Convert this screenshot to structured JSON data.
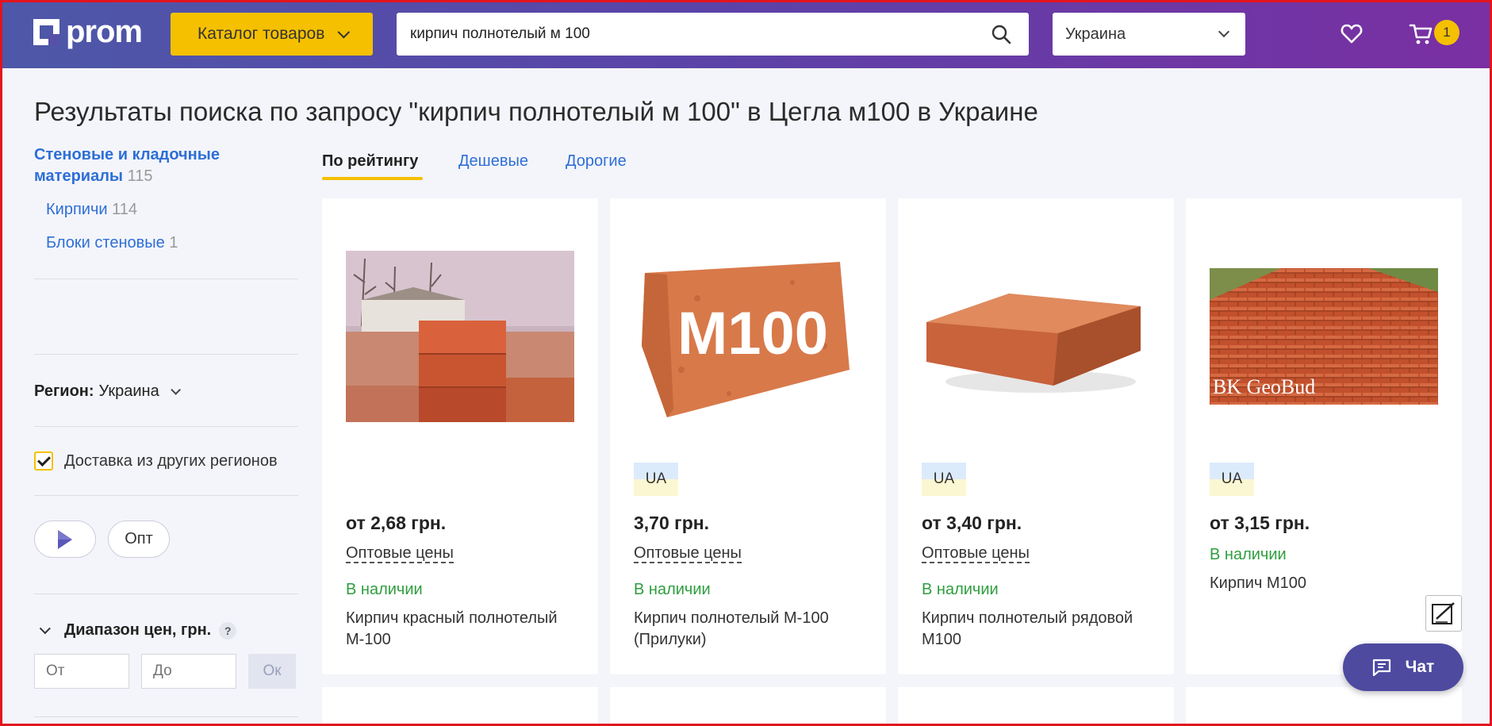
{
  "header": {
    "logo": "prom",
    "catalog_label": "Каталог товаров",
    "search_value": "кирпич полнотелый м 100",
    "region": "Украина",
    "cart_count": "1"
  },
  "page_title": "Результаты поиска по запросу \"кирпич полнотелый м 100\" в Цегла м100 в Украине",
  "sidebar": {
    "category_main_label": "Стеновые и кладочные материалы",
    "category_main_count": "115",
    "subcategories": [
      {
        "label": "Кирпичи",
        "count": "114"
      },
      {
        "label": "Блоки стеновые",
        "count": "1"
      }
    ],
    "region_label": "Регион:",
    "region_value": "Украина",
    "delivery_label": "Доставка из других регионов",
    "opt_label": "Опт",
    "price_range_label": "Диапазон цен, грн.",
    "help_glyph": "?",
    "price_from_placeholder": "От",
    "price_to_placeholder": "До",
    "ok_label": "Ок"
  },
  "sort_tabs": [
    {
      "label": "По рейтингу"
    },
    {
      "label": "Дешевые"
    },
    {
      "label": "Дорогие"
    }
  ],
  "products": [
    {
      "badge": "",
      "price": "от 2,68 грн.",
      "wholesale": "Оптовые цены",
      "stock": "В наличии",
      "name": "Кирпич красный полнотелый М-100",
      "image": "brick-stack-photo"
    },
    {
      "badge": "UA",
      "price": "3,70 грн.",
      "wholesale": "Оптовые цены",
      "stock": "В наличии",
      "name": "Кирпич полнотелый М-100 (Прилуки)",
      "image": "brick-m100-photo",
      "image_text": "M100"
    },
    {
      "badge": "UA",
      "price": "от 3,40 грн.",
      "wholesale": "Оптовые цены",
      "stock": "В наличии",
      "name": "Кирпич полнотелый рядовой М100",
      "image": "single-brick-photo"
    },
    {
      "badge": "UA",
      "price": "от 3,15 грн.",
      "wholesale": "",
      "stock": "В наличии",
      "name": "Кирпич М100",
      "image": "brick-pile-photo",
      "image_watermark": "BK GeoBud"
    }
  ],
  "chat_label": "Чат",
  "colors": {
    "accent_yellow": "#f5c000",
    "link_blue": "#2e6fd6",
    "stock_green": "#2e9e3e",
    "header_start": "#4d58a8",
    "header_end": "#7a2fa2",
    "chat_bg": "#4d4aa0"
  }
}
